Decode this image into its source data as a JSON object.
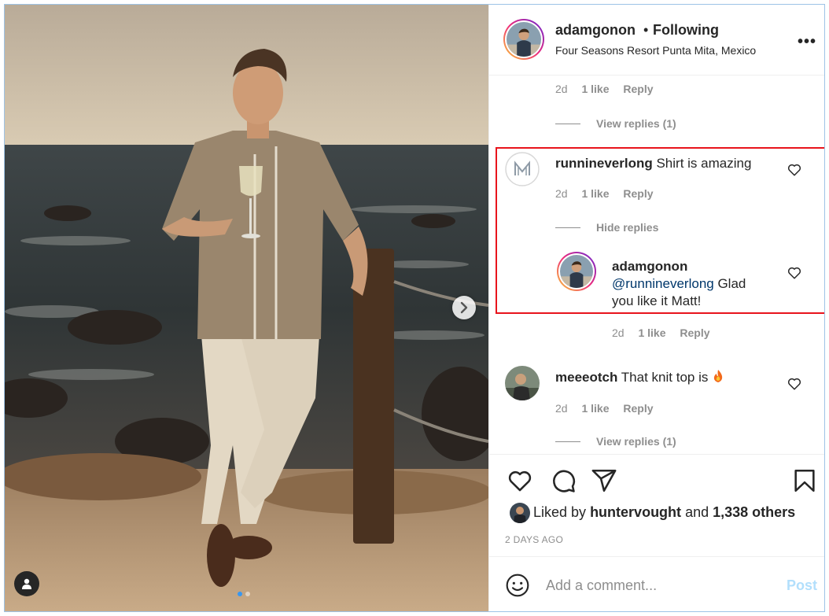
{
  "post": {
    "author": "adamgonon",
    "follow_status": "Following",
    "location": "Four Seasons Resort Punta Mita, Mexico",
    "more_icon": "more-horizontal-icon"
  },
  "comments": {
    "top_partial": {
      "time": "2d",
      "likes": "1 like",
      "reply": "Reply",
      "view_replies": "View replies (1)"
    },
    "items": [
      {
        "username": "runnineverlong",
        "text": "Shirt is amazing",
        "time": "2d",
        "likes": "1 like",
        "reply": "Reply",
        "replies_toggle": "Hide replies",
        "avatar_icon": "logo-m-icon"
      },
      {
        "username": "meeeotch",
        "text": "That knit top is",
        "emoji_icon": "fire-icon",
        "time": "2d",
        "likes": "1 like",
        "reply": "Reply",
        "replies_toggle": "View replies (1)"
      }
    ],
    "reply": {
      "username": "adamgonon",
      "mention": "@runnineverlong",
      "text_line1": " Glad",
      "text_line2": "you like it Matt!",
      "time": "2d",
      "likes": "1 like",
      "reply": "Reply"
    }
  },
  "actions": {
    "icons": [
      "heart-icon",
      "comment-icon",
      "share-icon",
      "bookmark-icon"
    ],
    "liked_by_prefix": "Liked by",
    "liked_by_user": "huntervought",
    "liked_by_and": "and",
    "liked_by_others": "1,338 others",
    "time_ago": "2 DAYS AGO"
  },
  "add_comment": {
    "placeholder": "Add a comment...",
    "post_label": "Post"
  },
  "carousel": {
    "slide_count": 2,
    "active_slide": 1
  },
  "colors": {
    "highlight_border": "#e8141c",
    "link_blue": "#00376b",
    "post_disabled": "#b2dffc",
    "muted": "#8e8e8e"
  }
}
